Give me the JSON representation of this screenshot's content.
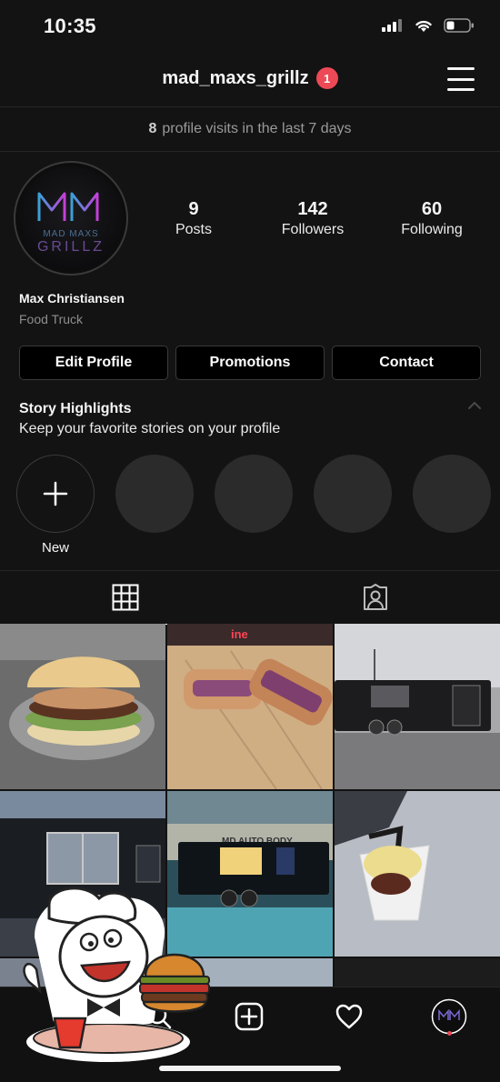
{
  "status_bar": {
    "time": "10:35"
  },
  "header": {
    "username": "mad_maxs_grillz",
    "notification_count": "1"
  },
  "visits": {
    "count": "8",
    "text": "profile visits in the last 7 days"
  },
  "avatar": {
    "line1": "MAD MAXS",
    "line2": "GRILLZ",
    "monogram": "MM"
  },
  "stats": [
    {
      "value": "9",
      "label": "Posts"
    },
    {
      "value": "142",
      "label": "Followers"
    },
    {
      "value": "60",
      "label": "Following"
    }
  ],
  "profile": {
    "name": "Max Christiansen",
    "category": "Food Truck"
  },
  "actions": {
    "edit": "Edit Profile",
    "promotions": "Promotions",
    "contact": "Contact"
  },
  "highlights": {
    "title": "Story Highlights",
    "subtitle": "Keep your favorite stories on your profile",
    "new_label": "New"
  },
  "tile_signs": {
    "truck_sign": "MD AUTO BODY",
    "store_sign": "ine"
  },
  "colors": {
    "accent": "#ed4956",
    "background": "#131313",
    "brand_gradient_start": "#3aa0d8",
    "brand_gradient_end": "#c43fd8"
  }
}
